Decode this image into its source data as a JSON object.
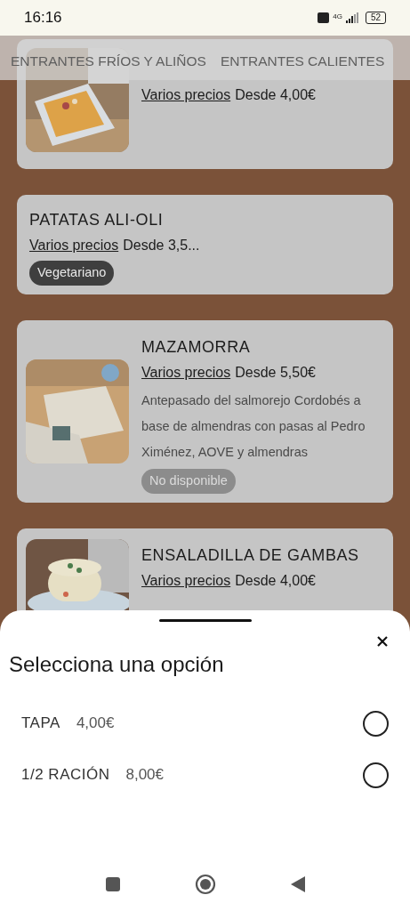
{
  "status_bar": {
    "time": "16:16",
    "network": "4G",
    "battery": "52"
  },
  "tabs": [
    {
      "label": "ENTRANTES FRÍOS Y ALIÑOS"
    },
    {
      "label": "ENTRANTES CALIENTES"
    }
  ],
  "products": [
    {
      "image": {
        "kind": "picture"
      },
      "price_link": "Varios precios",
      "price": "Desde 4,00€"
    },
    {
      "name": "PATATAS ALI-OLI",
      "price_link": "Varios precios",
      "price": "Desde 3,5...",
      "tags": [
        {
          "label": "Vegetariano",
          "kind": "diet"
        }
      ]
    },
    {
      "image": {
        "kind": "picture"
      },
      "name": "MAZAMORRA",
      "price_link": "Varios precios",
      "price": "Desde 5,50€",
      "description": "Antepasado del salmorejo Cordobés a base de almendras con pasas al Pedro Ximénez, AOVE y almendras",
      "tags": [
        {
          "label": "No disponible",
          "kind": "unavailable"
        }
      ]
    },
    {
      "image": {
        "kind": "picture"
      },
      "name": "ENSALADILLA DE GAMBAS",
      "price_link": "Varios precios",
      "price": "Desde 4,00€"
    }
  ],
  "sheet": {
    "title": "Selecciona una opción",
    "options": [
      {
        "label": "TAPA",
        "price": "4,00€",
        "selected": false
      },
      {
        "label": "1/2 RACIÓN",
        "price": "8,00€",
        "selected": false
      }
    ]
  }
}
